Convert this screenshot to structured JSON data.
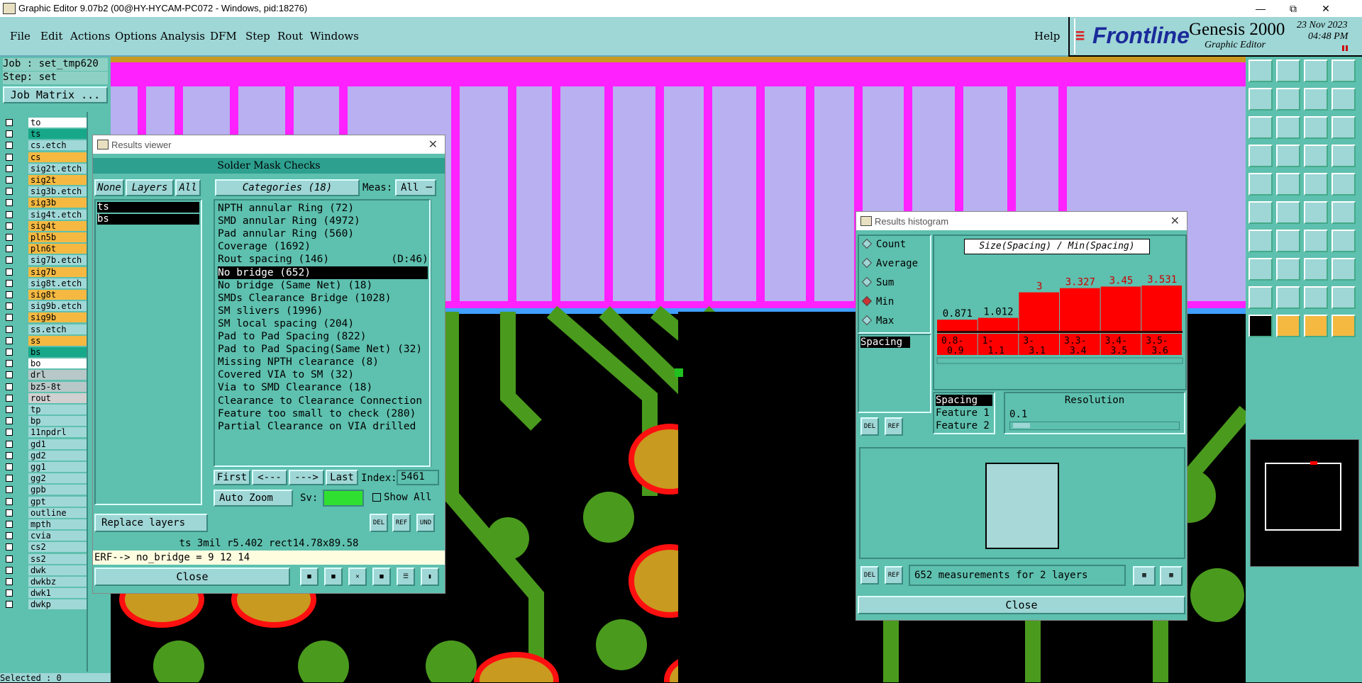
{
  "window": {
    "title": "Graphic Editor 9.07b2 (00@HY-HYCAM-PC072 - Windows, pid:18276)"
  },
  "menu": {
    "items": [
      "File",
      "Edit",
      "Actions",
      "Options",
      "Analysis",
      "DFM",
      "Step",
      "Rout",
      "Windows"
    ],
    "help": "Help"
  },
  "brand": {
    "logo": "Frontline",
    "product": "Genesis 2000",
    "subtitle": "Graphic Editor",
    "date": "23 Nov 2023",
    "time": "04:48 PM"
  },
  "job": {
    "job_line": "Job : set_tmp620",
    "step_line": "Step: set",
    "matrix_button": "Job Matrix ..."
  },
  "layers": [
    {
      "name": "to",
      "color": "#ffffff"
    },
    {
      "name": "ts",
      "color": "#17a88a"
    },
    {
      "name": "cs.etch",
      "color": "#a0d8d8"
    },
    {
      "name": "cs",
      "color": "#f5b942"
    },
    {
      "name": "sig2t.etch",
      "color": "#a0d8d8"
    },
    {
      "name": "sig2t",
      "color": "#f5b942"
    },
    {
      "name": "sig3b.etch",
      "color": "#a0d8d8"
    },
    {
      "name": "sig3b",
      "color": "#f5b942"
    },
    {
      "name": "sig4t.etch",
      "color": "#a0d8d8"
    },
    {
      "name": "sig4t",
      "color": "#f5b942"
    },
    {
      "name": "pln5b",
      "color": "#f5b942"
    },
    {
      "name": "pln6t",
      "color": "#f5b942"
    },
    {
      "name": "sig7b.etch",
      "color": "#a0d8d8"
    },
    {
      "name": "sig7b",
      "color": "#f5b942"
    },
    {
      "name": "sig8t.etch",
      "color": "#a0d8d8"
    },
    {
      "name": "sig8t",
      "color": "#f5b942"
    },
    {
      "name": "sig9b.etch",
      "color": "#a0d8d8"
    },
    {
      "name": "sig9b",
      "color": "#f5b942"
    },
    {
      "name": "ss.etch",
      "color": "#a0d8d8"
    },
    {
      "name": "ss",
      "color": "#f5b942"
    },
    {
      "name": "bs",
      "color": "#17a88a"
    },
    {
      "name": "bo",
      "color": "#ffffff"
    },
    {
      "name": "drl",
      "color": "#b8c8c8"
    },
    {
      "name": "bz5-8t",
      "color": "#b8c8c8"
    },
    {
      "name": "rout",
      "color": "#d0d0d0"
    },
    {
      "name": "tp",
      "color": "#a0d8d8"
    },
    {
      "name": "bp",
      "color": "#a0d8d8"
    },
    {
      "name": "11npdrl",
      "color": "#a0d8d8"
    },
    {
      "name": "gd1",
      "color": "#a0d8d8"
    },
    {
      "name": "gd2",
      "color": "#a0d8d8"
    },
    {
      "name": "gg1",
      "color": "#a0d8d8"
    },
    {
      "name": "gg2",
      "color": "#a0d8d8"
    },
    {
      "name": "gpb",
      "color": "#a0d8d8"
    },
    {
      "name": "gpt",
      "color": "#a0d8d8"
    },
    {
      "name": "outline",
      "color": "#a0d8d8"
    },
    {
      "name": "mpth",
      "color": "#a0d8d8"
    },
    {
      "name": "cvia",
      "color": "#a0d8d8"
    },
    {
      "name": "cs2",
      "color": "#a0d8d8"
    },
    {
      "name": "ss2",
      "color": "#a0d8d8"
    },
    {
      "name": "dwk",
      "color": "#a0d8d8"
    },
    {
      "name": "dwkbz",
      "color": "#a0d8d8"
    },
    {
      "name": "dwk1",
      "color": "#a0d8d8"
    },
    {
      "name": "dwkp",
      "color": "#a0d8d8"
    }
  ],
  "status": {
    "selected": "Selected : 0"
  },
  "results_viewer": {
    "title": "Results viewer",
    "header": "Solder Mask Checks",
    "none_btn": "None",
    "layers_btn": "Layers",
    "all_btn": "All",
    "categories_btn": "Categories (18)",
    "meas_label": "Meas:",
    "meas_value": "All",
    "layer_list": [
      "ts",
      "bs"
    ],
    "categories": [
      "NPTH annular Ring (72)",
      "SMD annular Ring (4972)",
      "Pad annular Ring (560)",
      "Coverage (1692)",
      "Rout spacing (146)          (D:46)",
      "No bridge (652)",
      "No bridge (Same Net) (18)",
      "SMDs Clearance Bridge (1028)",
      "SM slivers (1996)",
      "SM local spacing (204)",
      "Pad to Pad Spacing (822)",
      "Pad to Pad Spacing(Same Net) (32)",
      "Missing NPTH clearance (8)",
      "Covered VIA to SM (32)",
      "Via to SMD Clearance (18)",
      "Clearance to Clearance Connection",
      "Feature too small to check (280)",
      "Partial Clearance on VIA drilled"
    ],
    "selected_category": "No bridge (652)",
    "nav": {
      "first": "First",
      "prev": "<---",
      "next": "--->",
      "last": "Last",
      "index_label": "Index:",
      "index_value": "5461"
    },
    "zoom": "Auto Zoom",
    "sv_label": "Sv:",
    "show_all": "Show All",
    "replace": "Replace layers",
    "info_line": "ts 3mil  r5.402  rect14.78x89.58",
    "erf_line": "ERF--> no_bridge = 9 12 14",
    "close": "Close"
  },
  "histogram": {
    "title": "Results histogram",
    "chart_title": "Size(Spacing) / Min(Spacing)",
    "modes": [
      "Count",
      "Average",
      "Sum",
      "Min",
      "Max"
    ],
    "selected_mode": "Min",
    "list_item": "Spacing",
    "attr_list": [
      "Spacing",
      "Feature 1",
      "Feature 2"
    ],
    "resolution_label": "Resolution",
    "resolution_value": "0.1",
    "summary": "652 measurements for 2 layers",
    "close": "Close"
  },
  "chart_data": {
    "type": "bar",
    "title": "Size(Spacing) / Min(Spacing)",
    "categories": [
      "0.8-0.9",
      "1-1.1",
      "3-3.1",
      "3.3-3.4",
      "3.4-3.5",
      "3.5-3.6"
    ],
    "values": [
      0.871,
      1.012,
      3,
      3.327,
      3.45,
      3.531
    ],
    "value_labels": [
      "0.871",
      "1.012",
      "3",
      "3.327",
      "3.45",
      "3.531"
    ],
    "colors": {
      "bar": "#ff0000",
      "label": "#cc0000"
    }
  },
  "colors": {
    "panel": "#5ec0ae",
    "menu": "#9fd6d6",
    "mask_magenta": "#ff22ff",
    "mask_lavender": "#b8b0f0",
    "copper_green": "#4a9a1e",
    "pad_gold": "#c89a20",
    "clearance_red": "#ff1010"
  }
}
